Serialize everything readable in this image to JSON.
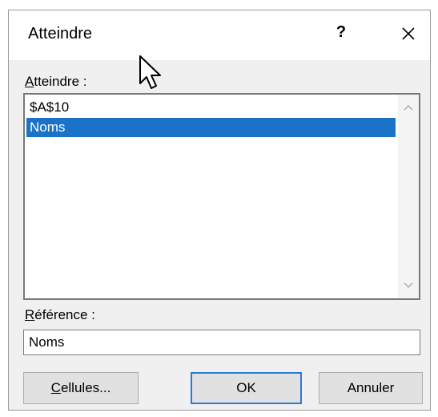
{
  "dialog": {
    "title": "Atteindre",
    "help_label": "?",
    "close_icon": "close-icon"
  },
  "goto": {
    "label_first": "A",
    "label_rest": "tteindre :",
    "items": [
      {
        "label": "$A$10",
        "selected": false
      },
      {
        "label": "Noms",
        "selected": true
      }
    ],
    "scroll_icons": [
      "chevron-up-icon",
      "chevron-down-icon"
    ]
  },
  "reference": {
    "label_first": "R",
    "label_rest": "éférence :",
    "value": "Noms"
  },
  "buttons": {
    "cells_first": "C",
    "cells_rest": "ellules...",
    "ok": "OK",
    "cancel": "Annuler"
  },
  "colors": {
    "selection": "#1a73c8",
    "ok_border": "#2a7bd6"
  }
}
